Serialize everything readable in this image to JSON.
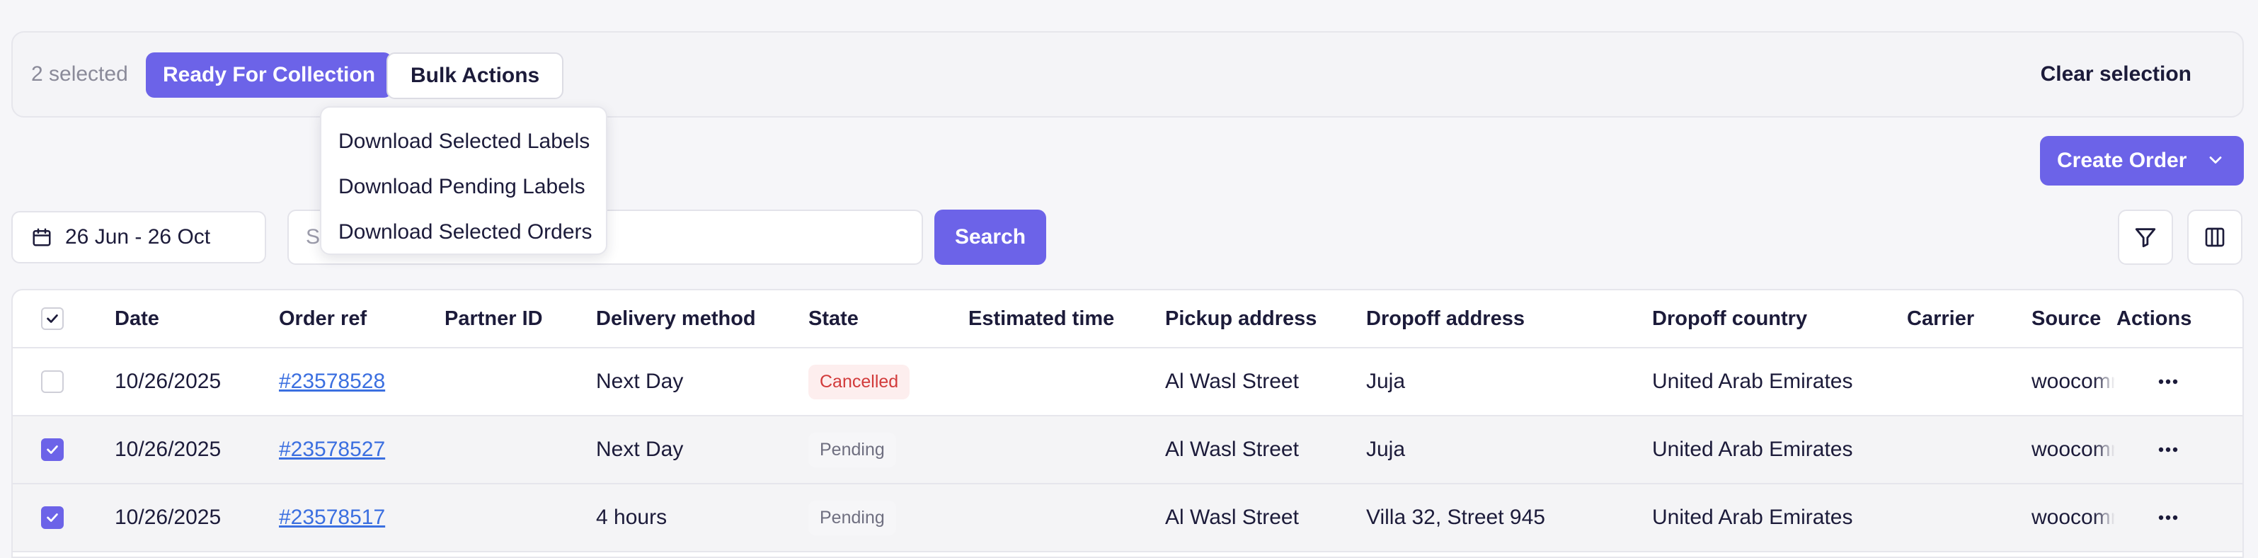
{
  "selection_bar": {
    "count_text": "2 selected",
    "ready_label": "Ready For Collection",
    "bulk_label": "Bulk Actions",
    "clear_label": "Clear selection"
  },
  "bulk_menu": {
    "items": [
      "Download Selected Labels",
      "Download Pending Labels",
      "Download Selected Orders"
    ]
  },
  "toolbar": {
    "create_label": "Create Order",
    "date_range": "26 Jun - 26 Oct",
    "search_placeholder": "Search by order id",
    "search_label": "Search"
  },
  "table": {
    "headers": {
      "date": "Date",
      "order_ref": "Order ref",
      "partner_id": "Partner ID",
      "delivery_method": "Delivery method",
      "state": "State",
      "estimated_time": "Estimated time",
      "pickup_address": "Pickup address",
      "dropoff_address": "Dropoff address",
      "dropoff_country": "Dropoff country",
      "carrier": "Carrier",
      "source": "Source",
      "actions": "Actions"
    },
    "rows": [
      {
        "checked": false,
        "date": "10/26/2025",
        "order_ref": "#23578528",
        "partner_id": "",
        "delivery_method": "Next Day",
        "state": "Cancelled",
        "estimated_time": "",
        "pickup_address": "Al Wasl Street",
        "dropoff_address": "Juja",
        "dropoff_country": "United Arab Emirates",
        "carrier": "",
        "source": "woocommerce"
      },
      {
        "checked": true,
        "date": "10/26/2025",
        "order_ref": "#23578527",
        "partner_id": "",
        "delivery_method": "Next Day",
        "state": "Pending",
        "estimated_time": "",
        "pickup_address": "Al Wasl Street",
        "dropoff_address": "Juja",
        "dropoff_country": "United Arab Emirates",
        "carrier": "",
        "source": "woocommerce"
      },
      {
        "checked": true,
        "date": "10/26/2025",
        "order_ref": "#23578517",
        "partner_id": "",
        "delivery_method": "4 hours",
        "state": "Pending",
        "estimated_time": "",
        "pickup_address": "Al Wasl Street",
        "dropoff_address": "Villa 32, Street 945",
        "dropoff_country": "United Arab Emirates",
        "carrier": "",
        "source": "woocommerce"
      }
    ]
  },
  "colors": {
    "accent": "#6c63e8",
    "link": "#3b6fe0",
    "cancelled": "#d23b3b"
  }
}
